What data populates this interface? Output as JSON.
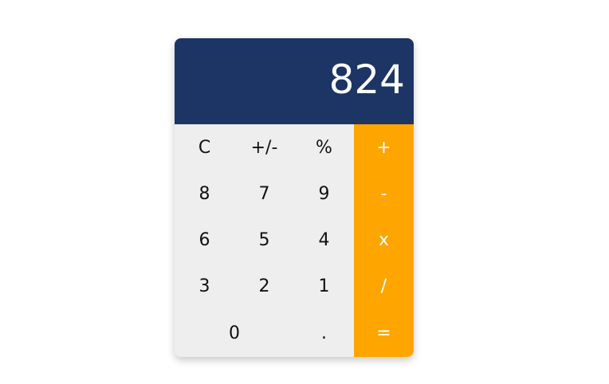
{
  "display": {
    "value": "824"
  },
  "keys": {
    "clear": "C",
    "sign": "+/-",
    "percent": "%",
    "add": "+",
    "d8": "8",
    "d7": "7",
    "d9": "9",
    "subtract": "-",
    "d6": "6",
    "d5": "5",
    "d4": "4",
    "multiply": "x",
    "d3": "3",
    "d2": "2",
    "d1": "1",
    "divide": "/",
    "d0": "0",
    "decimal": ".",
    "equals": "="
  },
  "colors": {
    "display_bg": "#1d3564",
    "keypad_bg": "#eeeeee",
    "operator_bg": "#ffa500",
    "operator_text": "#ffffff",
    "display_text": "#ffffff"
  }
}
